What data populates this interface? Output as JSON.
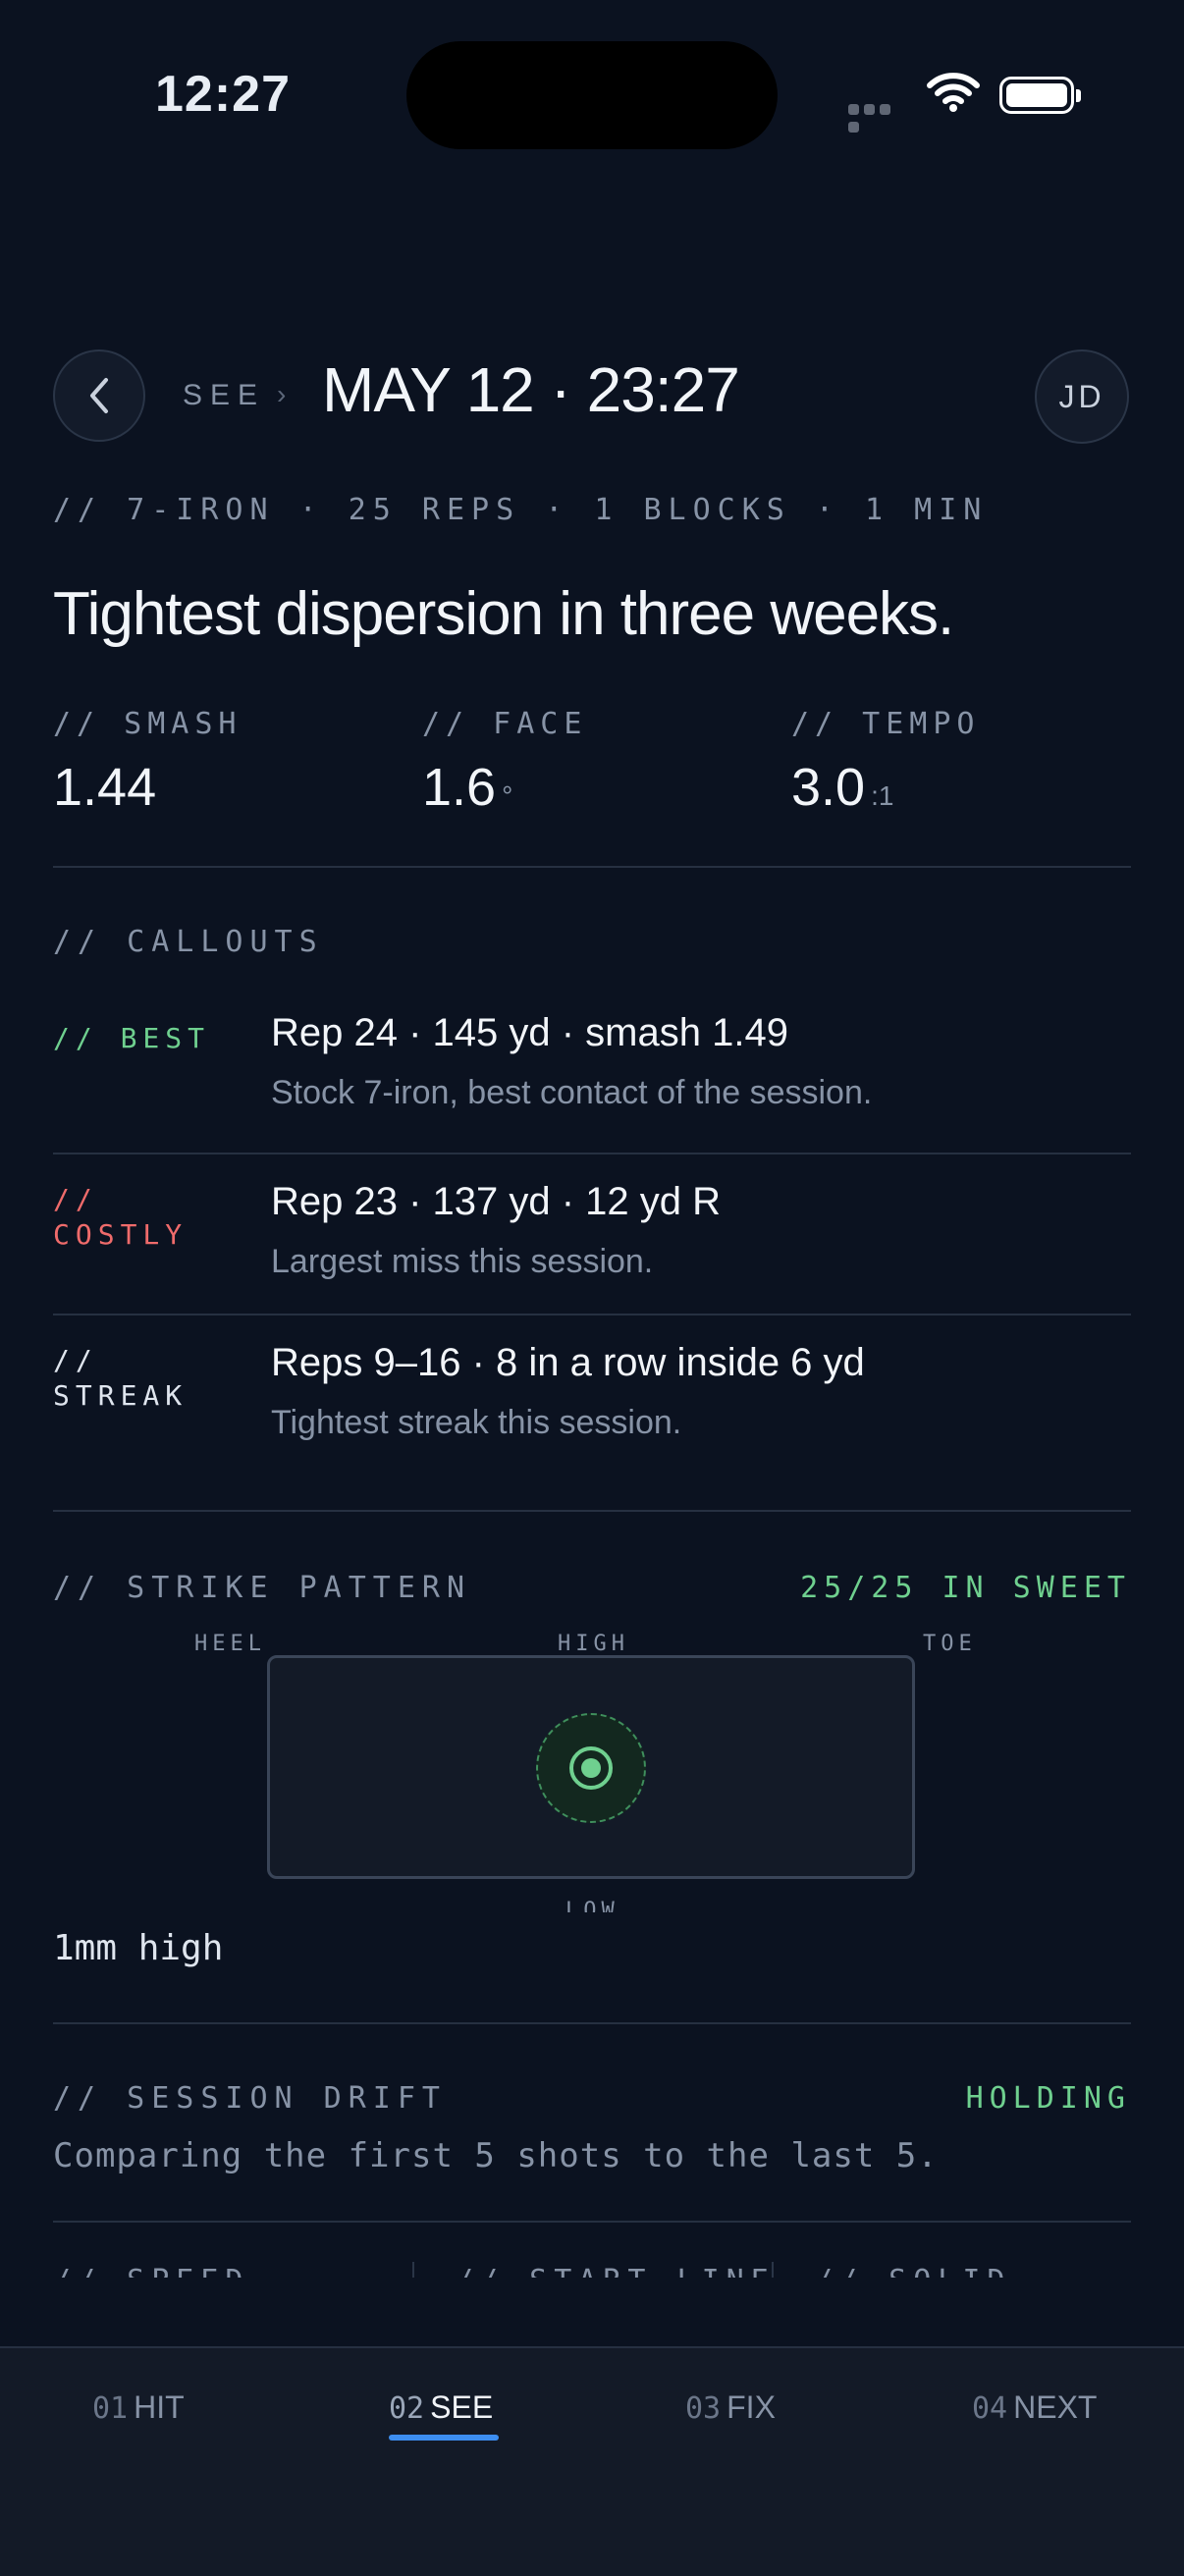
{
  "status_bar": {
    "time": "12:27"
  },
  "header": {
    "breadcrumb": "SEE",
    "breadcrumb_sep": "›",
    "title": "MAY 12 · 23:27",
    "avatar_initials": "JD"
  },
  "session": {
    "meta": "// 7-IRON · 25 REPS · 1 BLOCKS · 1 MIN",
    "headline": "Tightest dispersion in three weeks."
  },
  "stats": [
    {
      "label": "// SMASH",
      "value": "1.44",
      "unit": ""
    },
    {
      "label": "// FACE",
      "value": "1.6",
      "unit": "°"
    },
    {
      "label": "// TEMPO",
      "value": "3.0",
      "unit": ":1"
    }
  ],
  "callouts": {
    "label": "// CALLOUTS",
    "items": [
      {
        "tag": "// BEST",
        "title": "Rep 24 · 145 yd · smash 1.49",
        "detail": "Stock 7-iron, best contact of the session.",
        "color": "#6fd08f"
      },
      {
        "tag": "// COSTLY",
        "title": "Rep 23 · 137 yd · 12 yd R",
        "detail": "Largest miss this session.",
        "color": "#ef6b6b"
      },
      {
        "tag": "// STREAK",
        "title": "Reps 9–16 · 8 in a row inside 6 yd",
        "detail": "Tightest streak this session.",
        "color": "#dfe5ee"
      }
    ]
  },
  "strike_pattern": {
    "label": "// STRIKE PATTERN",
    "summary": "25/25 IN SWEET",
    "heel": "HEEL",
    "high": "HIGH",
    "toe": "TOE",
    "low": "LOW",
    "note": "1mm high"
  },
  "session_drift": {
    "label": "// SESSION DRIFT",
    "status": "HOLDING",
    "note": "Comparing the first 5 shots to the last 5.",
    "metrics": [
      "// SPEED",
      "// START LINE",
      "// SOLID"
    ]
  },
  "tabs": [
    {
      "num": "01",
      "label": "HIT"
    },
    {
      "num": "02",
      "label": "SEE"
    },
    {
      "num": "03",
      "label": "FIX"
    },
    {
      "num": "04",
      "label": "NEXT"
    }
  ],
  "colors": {
    "accent_blue": "#3d8ef0",
    "good_green": "#6fd08f",
    "bad_red": "#ef6b6b",
    "background": "#0b1220"
  }
}
